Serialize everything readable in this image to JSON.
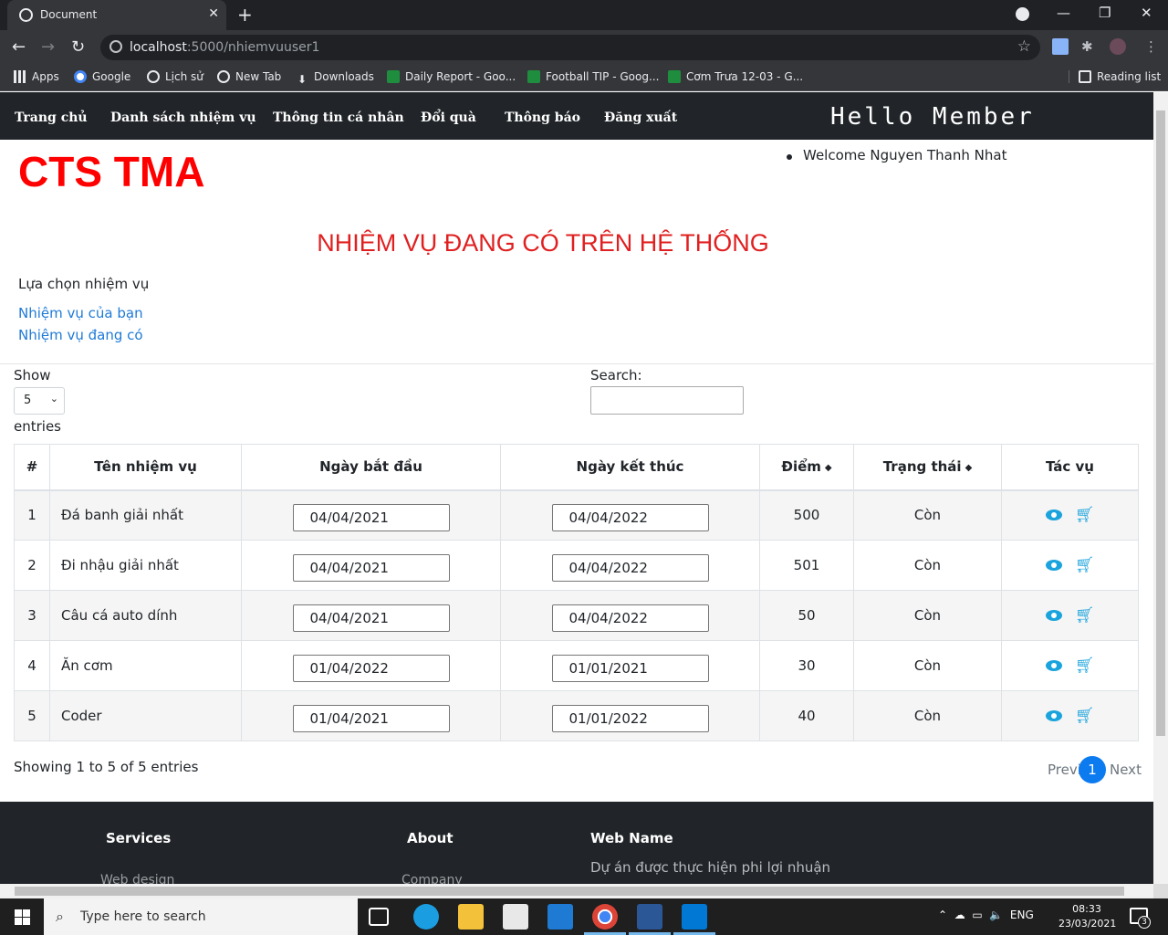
{
  "browser": {
    "tab_title": "Document",
    "url_host": "localhost",
    "url_rest": ":5000/nhiemvuuser1",
    "bookmarks": [
      {
        "label": "Apps",
        "icon": "apps-grid-icon"
      },
      {
        "label": "Google",
        "icon": "google-icon"
      },
      {
        "label": "Lịch sử",
        "icon": "history-icon"
      },
      {
        "label": "New Tab",
        "icon": "globe-icon"
      },
      {
        "label": "Downloads",
        "icon": "download-icon"
      },
      {
        "label": "Daily Report - Goo...",
        "icon": "sheets-icon"
      },
      {
        "label": "Football TIP - Goog...",
        "icon": "sheets-icon"
      },
      {
        "label": "Cơm Trưa 12-03 - G...",
        "icon": "sheets-icon"
      }
    ],
    "reading_list": "Reading list"
  },
  "site": {
    "nav": [
      "Trang chủ",
      "Danh sách nhiệm vụ",
      "Thông tin cá nhân",
      "Đổi quà",
      "Thông báo",
      "Đăng xuất"
    ],
    "hello": "Hello Member",
    "brand": "CTS TMA",
    "welcome": "Welcome Nguyen Thanh Nhat",
    "heading": "NHIỆM VỤ ĐANG CÓ TRÊN HỆ THỐNG",
    "choose_label": "Lựa chọn nhiệm vụ",
    "links": [
      "Nhiệm vụ của bạn",
      "Nhiệm vụ đang có"
    ]
  },
  "datatable": {
    "show_label": "Show",
    "show_value": "5",
    "entries_label": "entries",
    "search_label": "Search:",
    "search_value": "",
    "columns": [
      "#",
      "Tên nhiệm vụ",
      "Ngày bắt đầu",
      "Ngày kết thúc",
      "Điểm",
      "Trạng thái",
      "Tác vụ"
    ],
    "rows": [
      {
        "idx": "1",
        "name": "Đá banh giải nhất",
        "start": "04/04/2021",
        "end": "04/04/2022",
        "points": "500",
        "status": "Còn"
      },
      {
        "idx": "2",
        "name": "Đi nhậu giải nhất",
        "start": "04/04/2021",
        "end": "04/04/2022",
        "points": "501",
        "status": "Còn"
      },
      {
        "idx": "3",
        "name": "Câu cá auto dính",
        "start": "04/04/2021",
        "end": "04/04/2022",
        "points": "50",
        "status": "Còn"
      },
      {
        "idx": "4",
        "name": "Ăn cơm",
        "start": "01/04/2022",
        "end": "01/01/2021",
        "points": "30",
        "status": "Còn"
      },
      {
        "idx": "5",
        "name": "Coder",
        "start": "01/04/2021",
        "end": "01/01/2022",
        "points": "40",
        "status": "Còn"
      }
    ],
    "info": "Showing 1 to 5 of 5 entries",
    "prev": "Previous",
    "current_page": "1",
    "next": "Next"
  },
  "footer": {
    "services_title": "Services",
    "services_first": "Web design",
    "about_title": "About",
    "about_first": "Company",
    "webname_title": "Web Name",
    "webname_desc": "Dự án được thực hiện phi lợi nhuận"
  },
  "taskbar": {
    "search_placeholder": "Type here to search",
    "lang": "ENG",
    "time": "08:33",
    "date": "23/03/2021",
    "notifications": "3"
  },
  "colors": {
    "brand_red": "#ff0000",
    "link_blue": "#1e7ad6",
    "icon_blue": "#1aa3dc",
    "page_active": "#0d7bf0",
    "nav_bg": "#212529"
  }
}
